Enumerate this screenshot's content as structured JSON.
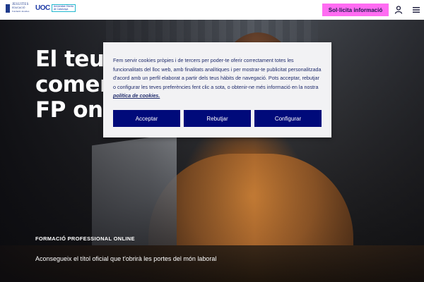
{
  "header": {
    "logo_jesuites": {
      "line1": "JESUITES",
      "line2": "EDUCACIÓ",
      "line3": "Fundació Jesuïtes"
    },
    "logo_uoc": {
      "mark": "UOC",
      "line1": "Universitat Oberta",
      "line2": "de Catalunya"
    },
    "cta_label": "Sol·licita informació",
    "cta_color": "#ff6cf2",
    "icons": [
      "user-icon",
      "menu-icon"
    ]
  },
  "hero": {
    "title_lines": [
      "El teu futur",
      "comença amb",
      "FP online"
    ],
    "eyebrow": "FORMACIÓ PROFESSIONAL ONLINE",
    "subtitle": "Aconsegueix el títol oficial que t'obrirà les portes del món laboral"
  },
  "cookie_banner": {
    "text": "Fem servir cookies pròpies i de tercers per poder-te oferir correctament totes les funcionalitats del lloc web, amb finalitats analítiques i per mostrar-te publicitat personalitzada d'acord amb un perfil elaborat a partir dels teus hàbits de navegació. Pots acceptar, rebutjar o configurar les teves preferències fent clic a sota, o obtenir-ne més informació en la nostra ",
    "link_text": "política de cookies.",
    "buttons": {
      "accept": "Acceptar",
      "reject": "Rebutjar",
      "configure": "Configurar"
    },
    "button_color": "#000a7a"
  }
}
